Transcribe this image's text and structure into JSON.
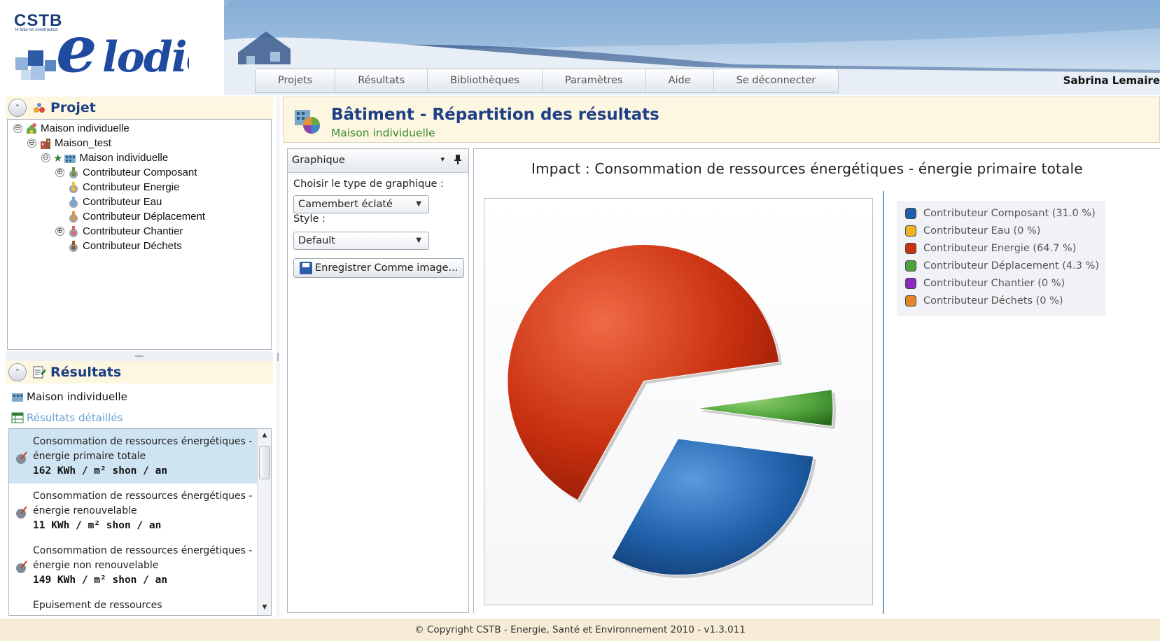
{
  "app": {
    "brand": "CSTB",
    "brand_tagline": "le futur en construction",
    "product_name": "Elodié",
    "user_name": "Sabrina  Lemaire"
  },
  "nav": {
    "tabs": [
      "Projets",
      "Résultats",
      "Bibliothèques",
      "Paramètres",
      "Aide",
      "Se déconnecter"
    ]
  },
  "projet_panel": {
    "title": "Projet",
    "collapse_glyph": "⌃",
    "tree": [
      {
        "label": "Maison individuelle",
        "level": 0,
        "toggle": "⊖",
        "icon": "project-icon"
      },
      {
        "label": "Maison_test",
        "level": 1,
        "toggle": "⊖",
        "icon": "building-icon"
      },
      {
        "label": "Maison individuelle",
        "level": 2,
        "toggle": "⊖",
        "icon": "house-block-icon",
        "starred": true
      },
      {
        "label": "Contributeur Composant",
        "level": 3,
        "toggle": "⊕",
        "icon": "contributor-composant-icon"
      },
      {
        "label": "Contributeur Energie",
        "level": 3,
        "toggle": "",
        "icon": "contributor-energie-icon"
      },
      {
        "label": "Contributeur Eau",
        "level": 3,
        "toggle": "",
        "icon": "contributor-eau-icon"
      },
      {
        "label": "Contributeur Déplacement",
        "level": 3,
        "toggle": "",
        "icon": "contributor-deplacement-icon"
      },
      {
        "label": "Contributeur Chantier",
        "level": 3,
        "toggle": "⊕",
        "icon": "contributor-chantier-icon"
      },
      {
        "label": "Contributeur Déchets",
        "level": 3,
        "toggle": "",
        "icon": "contributor-dechets-icon"
      }
    ]
  },
  "resultats_panel": {
    "title": "Résultats",
    "maison_label": "Maison individuelle",
    "detail_link": "Résultats détaillés",
    "items": [
      {
        "title": "Consommation de ressources énergétiques - énergie primaire totale",
        "value": "162 KWh / m² shon / an",
        "selected": true
      },
      {
        "title": "Consommation de ressources énergétiques - énergie renouvelable",
        "value": "11 KWh / m² shon / an",
        "selected": false
      },
      {
        "title": "Consommation de ressources énergétiques - énergie non renouvelable",
        "value": "149 KWh / m² shon / an",
        "selected": false
      },
      {
        "title": "Epuisement de ressources",
        "value": "",
        "selected": false
      }
    ],
    "scroll_up": "▲",
    "scroll_down": "▼"
  },
  "main": {
    "title": "Bâtiment - Répartition des résultats",
    "subtitle": "Maison individuelle"
  },
  "options": {
    "header": "Graphique",
    "caret": "▾",
    "pin": "📌",
    "type_label": "Choisir le type de graphique :",
    "type_value": "Camembert éclaté",
    "style_label": "Style :",
    "style_value": "Default",
    "dd_caret": "▼",
    "save_label": "Enregistrer Comme image..."
  },
  "chart_data": {
    "type": "pie",
    "title": "Impact : Consommation de ressources énergétiques - énergie primaire totale",
    "exploded": true,
    "series": [
      {
        "name": "Contributeur Composant",
        "value": 31.0,
        "label": "Contributeur Composant (31.0 %)",
        "color": "#1f5fa8"
      },
      {
        "name": "Contributeur Eau",
        "value": 0,
        "label": "Contributeur Eau (0 %)",
        "color": "#f0b323"
      },
      {
        "name": "Contributeur Energie",
        "value": 64.7,
        "label": "Contributeur Energie (64.7 %)",
        "color": "#c8300f"
      },
      {
        "name": "Contributeur Déplacement",
        "value": 4.3,
        "label": "Contributeur Déplacement (4.3 %)",
        "color": "#4ea23a"
      },
      {
        "name": "Contributeur Chantier",
        "value": 0,
        "label": "Contributeur Chantier (0 %)",
        "color": "#8a2bbf"
      },
      {
        "name": "Contributeur Déchets",
        "value": 0,
        "label": "Contributeur Déchets (0 %)",
        "color": "#e6862a"
      }
    ],
    "legend_position": "right"
  },
  "footer": {
    "text": "© Copyright CSTB - Energie, Santé et Environnement 2010 - v1.3.011"
  }
}
